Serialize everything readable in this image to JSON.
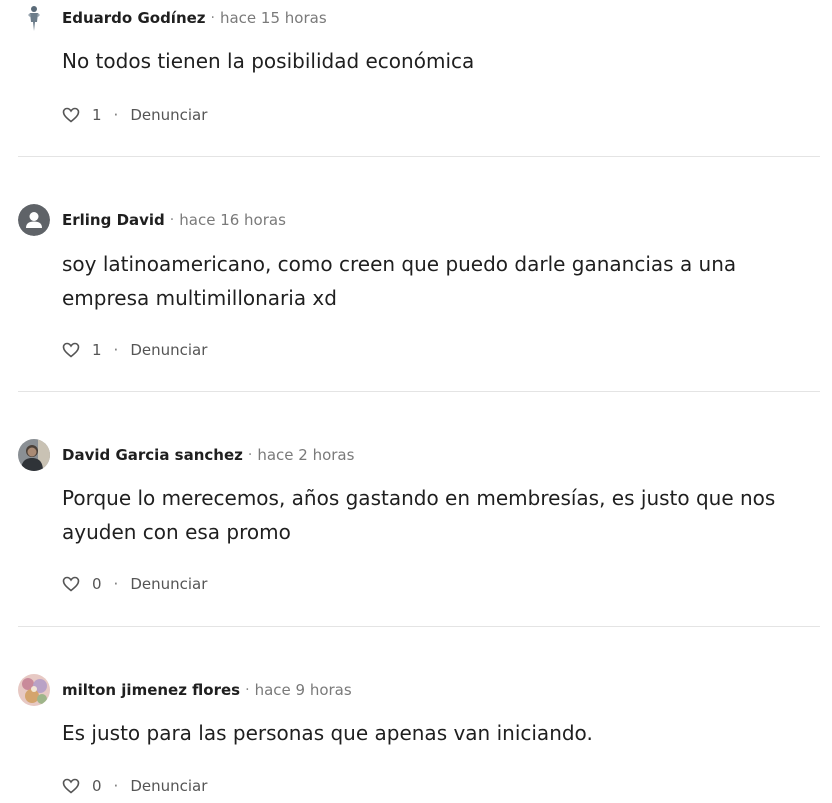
{
  "comments": [
    {
      "author": "Eduardo Godínez",
      "separator": "·",
      "time": "hace 15 horas",
      "text": "No todos tienen la posibilidad económica",
      "likes": "1",
      "report_label": "Denunciar",
      "avatar": "user-photo"
    },
    {
      "author": "Erling David",
      "separator": "·",
      "time": "hace 16 horas",
      "text": "soy latinoamericano, como creen que puedo darle ganancias a una empresa multimillonaria xd",
      "likes": "1",
      "report_label": "Denunciar",
      "avatar": "default-user-icon"
    },
    {
      "author": "David Garcia sanchez",
      "separator": "·",
      "time": "hace 2 horas",
      "text": "Porque lo merecemos, años gastando en membresías, es justo que nos ayuden con esa promo",
      "likes": "0",
      "report_label": "Denunciar",
      "avatar": "user-photo"
    },
    {
      "author": "milton jimenez flores",
      "separator": "·",
      "time": "hace 9 horas",
      "text": "Es justo para las personas que apenas van iniciando.",
      "likes": "0",
      "report_label": "Denunciar",
      "avatar": "user-photo"
    }
  ],
  "action_separator": "·",
  "colors": {
    "text": "#1f1f1f",
    "muted": "#7a7a7a",
    "divider": "#e4e4e4"
  }
}
